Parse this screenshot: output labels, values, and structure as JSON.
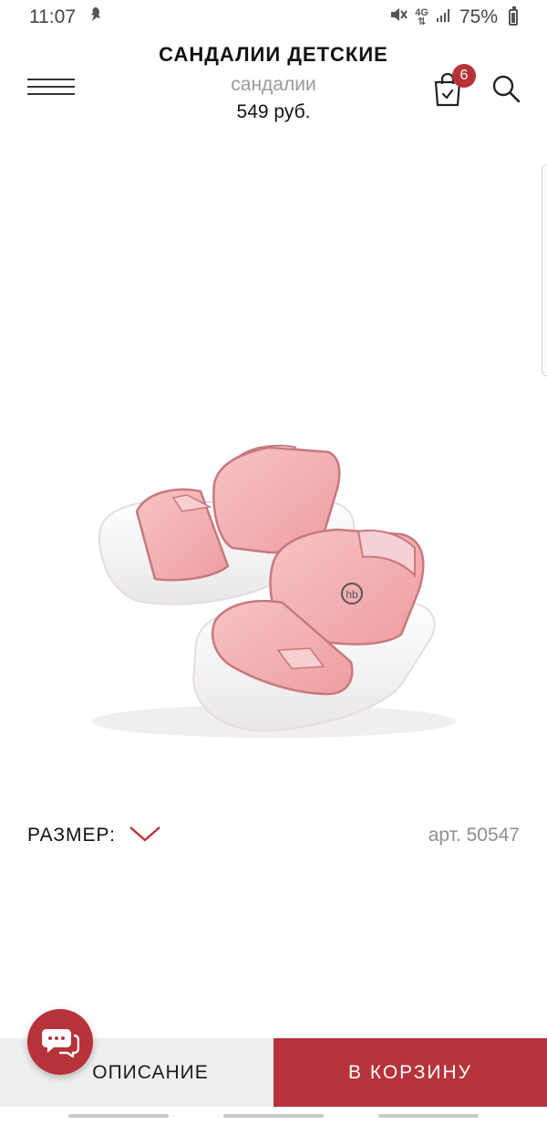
{
  "status_bar": {
    "time": "11:07",
    "network": "4G",
    "battery": "75%",
    "icons": [
      "notification-icon",
      "mute-icon",
      "network-icon",
      "signal-icon",
      "battery-icon"
    ]
  },
  "header": {
    "title": "САНДАЛИИ ДЕТСКИЕ",
    "subtitle": "сандалии",
    "price": "549 руб.",
    "cart_count": "6",
    "icons": [
      "menu-icon",
      "cart-icon",
      "search-icon"
    ]
  },
  "product": {
    "logo_text": "hb",
    "colors": {
      "strap": "#f3b7b8",
      "strap_edge": "#c7797e",
      "sole": "#f6f4f4",
      "accent": "#b8323a"
    }
  },
  "size": {
    "label": "РАЗМЕР:",
    "article": "арт. 50547"
  },
  "bottom": {
    "description_label": "ОПИСАНИЕ",
    "add_to_cart_label": "В КОРЗИНУ"
  }
}
